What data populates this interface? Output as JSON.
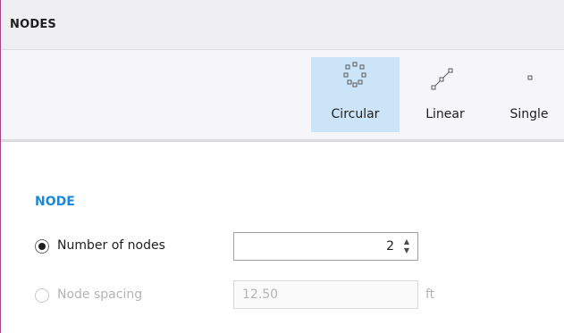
{
  "header": {
    "title": "NODES"
  },
  "toolbar": {
    "modes": [
      {
        "label": "Circular",
        "icon": "circular-nodes-icon",
        "selected": true
      },
      {
        "label": "Linear",
        "icon": "linear-nodes-icon",
        "selected": false
      },
      {
        "label": "Single",
        "icon": "single-node-icon",
        "selected": false
      }
    ]
  },
  "node": {
    "section_title": "NODE",
    "number_of_nodes": {
      "label": "Number of nodes",
      "value": "2",
      "checked": true,
      "enabled": true
    },
    "node_spacing": {
      "label": "Node spacing",
      "value": "12.50",
      "unit": "ft",
      "checked": false,
      "enabled": false
    }
  },
  "colors": {
    "accent": "#1e88d8",
    "selected_bg": "#cce4f7",
    "header_bg": "#efeff2",
    "left_border": "#a4478a"
  }
}
